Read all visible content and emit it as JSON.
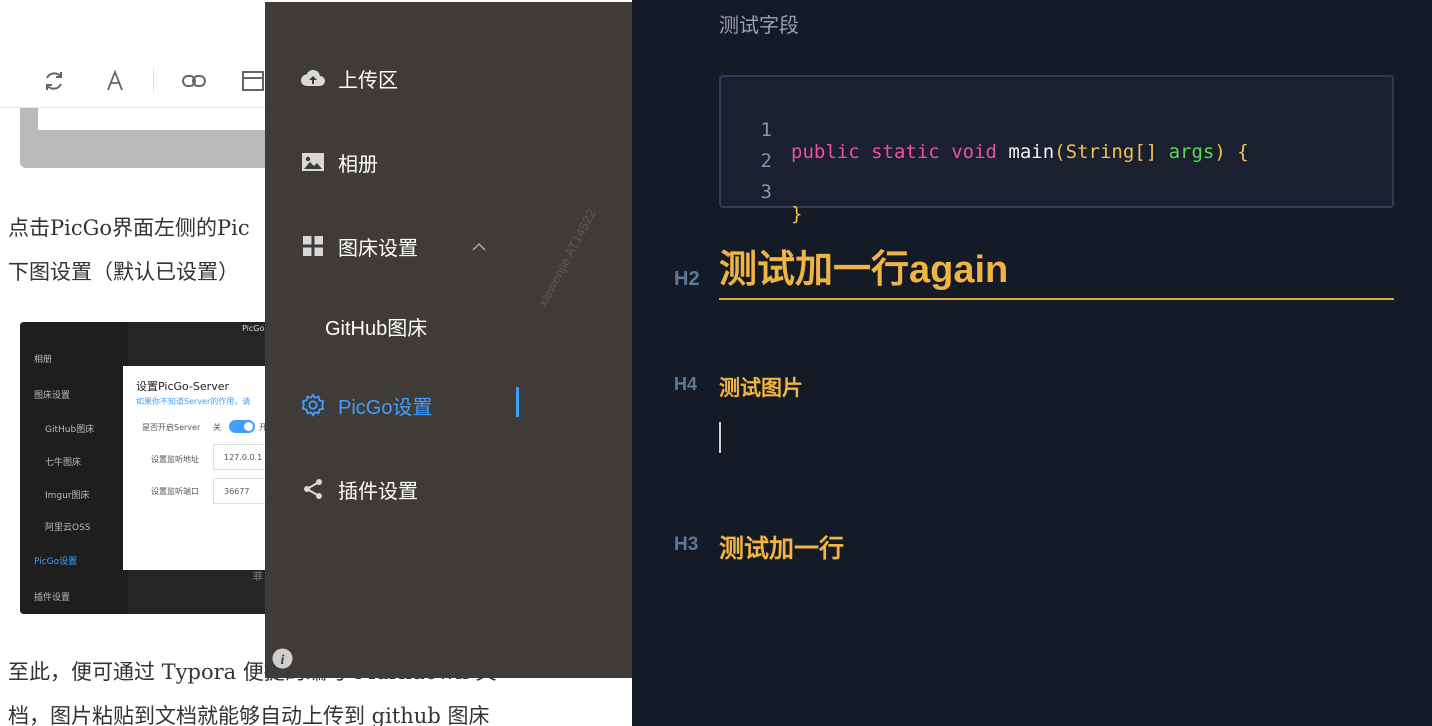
{
  "article": {
    "para1_line1": "点击PicGo界面左侧的Pic",
    "para1_line2": "下图设置（默认已设置）",
    "para2_line1": "至此，便可通过 Typora 便捷的编写 Markdown 文",
    "para2_line2": "档，图片粘贴到文档就能够自动上传到 github 图床",
    "toolbar_icons": [
      "refresh-icon",
      "font-icon",
      "link-icon",
      "window-icon"
    ],
    "embed": {
      "title": "PicGo",
      "sidebar": [
        "相册",
        "图床设置",
        "GitHub图床",
        "七牛图床",
        "Imgur图床",
        "阿里云OSS",
        "PicGo设置",
        "插件设置"
      ],
      "dialog_title": "设置PicGo-Server",
      "dialog_tip": "如果你不知道Server的作用，请",
      "server_label": "是否开启Server",
      "server_off": "关",
      "server_on": "开",
      "host_label": "设置监听地址",
      "host_value": "127.0.0.1",
      "port_label": "设置监听端口",
      "port_value": "36677",
      "fragment": "菲"
    }
  },
  "picgo": {
    "nav": [
      {
        "label": "上传区",
        "icon": "cloud-upload-icon"
      },
      {
        "label": "相册",
        "icon": "image-icon"
      },
      {
        "label": "图床设置",
        "icon": "grid-icon"
      },
      {
        "label": "GitHub图床"
      },
      {
        "label": "PicGo设置",
        "icon": "gear-icon",
        "active": true
      },
      {
        "label": "插件设置",
        "icon": "share-icon"
      }
    ],
    "watermark": "xiewenjie   AT14522",
    "accent": "#409EFF",
    "bg": "#3f3c37"
  },
  "typora": {
    "prev_line": "测试字段",
    "code": {
      "line_numbers": [
        "1",
        "2",
        "3"
      ],
      "line1": {
        "kw1": "public",
        "kw2": "static",
        "kw3": "void",
        "fn": "main",
        "open": "(",
        "type": "String[]",
        "param": "args",
        "close": ")",
        "brace": "{"
      },
      "line3": "}"
    },
    "h2": {
      "marker": "H2",
      "text": "测试加一行again"
    },
    "h4": {
      "marker": "H4",
      "text": "测试图片"
    },
    "h3": {
      "marker": "H3",
      "text": "测试加一行"
    },
    "colors": {
      "bg": "#151a27",
      "heading": "#f0b442",
      "keyword": "#ec4fa5",
      "param": "#5bdc4e"
    }
  }
}
